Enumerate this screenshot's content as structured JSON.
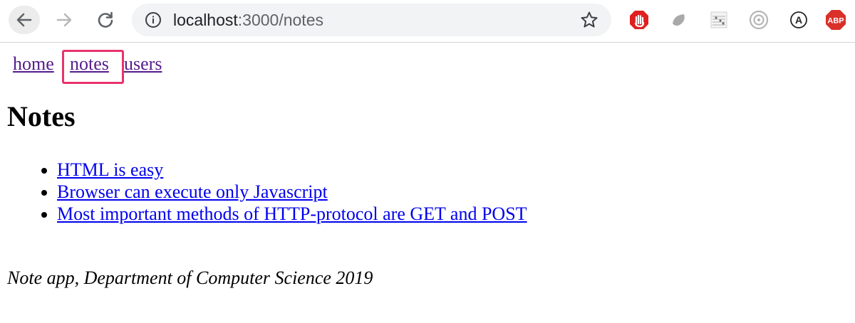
{
  "browser": {
    "url_host": "localhost",
    "url_rest": ":3000/notes",
    "extensions": [
      "stop-hand-icon",
      "leaf-icon",
      "music-sheet-icon",
      "target-icon",
      "a-circle-icon",
      "adblock-plus-icon"
    ],
    "extension_abp_label": "ABP",
    "extension_a_label": "A"
  },
  "nav": {
    "home": "home",
    "notes": "notes",
    "users": "users"
  },
  "page": {
    "title": "Notes",
    "notes": [
      "HTML is easy",
      "Browser can execute only Javascript",
      "Most important methods of HTTP-protocol are GET and POST"
    ],
    "footer": "Note app, Department of Computer Science 2019"
  },
  "colors": {
    "visited_link": "#551a8b",
    "link": "#0000ee",
    "highlight": "#e8336d",
    "abp_red": "#d9302a"
  }
}
